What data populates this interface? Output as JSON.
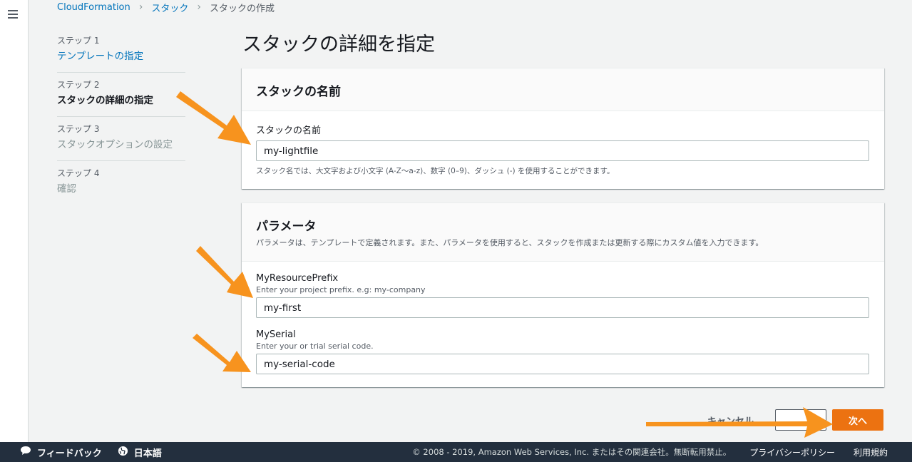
{
  "breadcrumb": {
    "items": [
      "CloudFormation",
      "スタック",
      "スタックの作成"
    ]
  },
  "steps": [
    {
      "num": "ステップ 1",
      "label": "テンプレートの指定"
    },
    {
      "num": "ステップ 2",
      "label": "スタックの詳細の指定"
    },
    {
      "num": "ステップ 3",
      "label": "スタックオプションの設定"
    },
    {
      "num": "ステップ 4",
      "label": "確認"
    }
  ],
  "page": {
    "title": "スタックの詳細を指定"
  },
  "stack_name_panel": {
    "title": "スタックの名前",
    "field_label": "スタックの名前",
    "value": "my-lightfile",
    "hint": "スタック名では、大文字および小文字 (A-Z〜a-z)、数字 (0–9)、ダッシュ (-) を使用することができます。"
  },
  "params_panel": {
    "title": "パラメータ",
    "description": "パラメータは、テンプレートで定義されます。また、パラメータを使用すると、スタックを作成または更新する際にカスタム値を入力できます。",
    "fields": [
      {
        "label": "MyResourcePrefix",
        "desc": "Enter your project prefix. e.g: my-company",
        "value": "my-first"
      },
      {
        "label": "MySerial",
        "desc": "Enter your or trial serial code.",
        "value": "my-serial-code"
      }
    ]
  },
  "actions": {
    "cancel_label": "キャンセル",
    "next_label": "次へ"
  },
  "footer": {
    "feedback_label": "フィードバック",
    "language_label": "日本語",
    "copyright": "© 2008 - 2019, Amazon Web Services, Inc. またはその関連会社。無断転用禁止。",
    "privacy_label": "プライバシーポリシー",
    "terms_label": "利用規約"
  },
  "colors": {
    "link": "#0073bb",
    "primary_button": "#ec7211",
    "footer_bg": "#232f3e",
    "annotation_arrow": "#f7931e"
  }
}
